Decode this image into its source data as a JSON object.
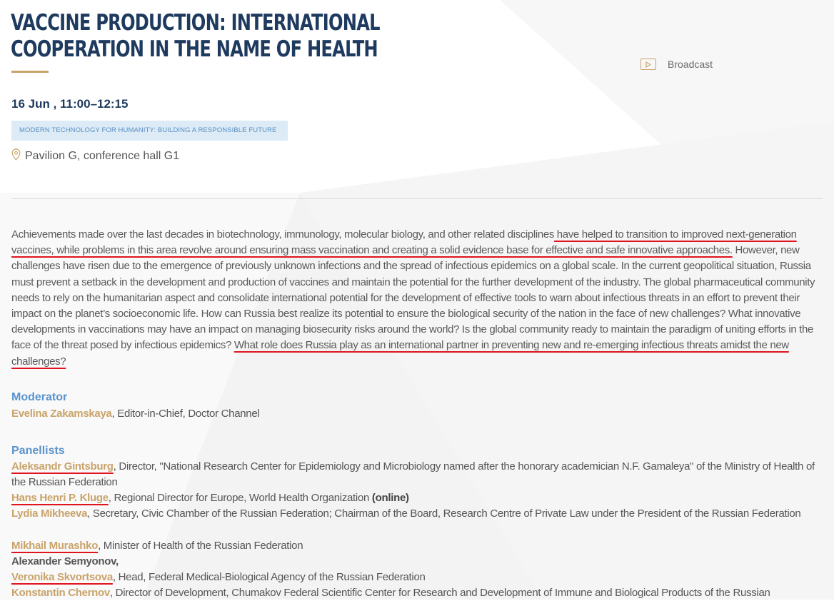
{
  "title": "Vaccine Production: International Cooperation in the Name of Health",
  "broadcast": {
    "label": "Broadcast",
    "icon": "play-icon"
  },
  "date": "16 Jun , 11:00–12:15",
  "tag": "Modern Technology for Humanity: Building a Responsible Future",
  "location": {
    "icon": "location-pin-icon",
    "label": "Pavilion G, conference hall G1"
  },
  "description": {
    "p1": "Achievements made over the last decades in biotechnology, immunology, molecular biology, and other related disciplines",
    "u1": " have helped to transition to improved next-generation vaccines, while problems in this area revolve around ensuring mass vaccination and creating a solid evidence base for effective and safe innovative approaches.",
    "p2": " However, new challenges have risen due to the emergence of previously unknown infections and the spread of infectious epidemics on a global scale. In the current geopolitical situation, Russia must prevent a setback in the development and production of vaccines and maintain the potential for the further development of the industry. The global pharmaceutical community needs to rely on the humanitarian aspect and consolidate international potential for the development of effective tools to warn about infectious threats in an effort to prevent their impact on the planet’s socioeconomic life. How can Russia best realize its potential to ensure the biological security of the nation in the face of new challenges? What innovative developments in vaccinations may have an impact on managing biosecurity risks around the world? Is the global community ready to maintain the paradigm of uniting efforts in the face of the threat posed by infectious epidemics? ",
    "u2": "What role does Russia play as an international partner in preventing new and re-emerging infectious threats amidst the new challenges?"
  },
  "moderator": {
    "heading": "Moderator",
    "name": "Evelina Zakamskaya",
    "role": ", Editor-in-Chief, Doctor Channel"
  },
  "panellists": {
    "heading": "Panellists",
    "items": [
      {
        "name": "Aleksandr Gintsburg",
        "role": ", Director, \"National Research Center for Epidemiology and Microbiology named after the honorary academician N.F. Gamaleya\" of the Ministry of Health of the Russian Federation"
      },
      {
        "name": "Hans Henri P. Kluge",
        "role": ", Regional Director for Europe, World Health Organization ",
        "extra": "(online)"
      },
      {
        "name": "Lydia Mikheeva",
        "role": ", Secretary, Civic Chamber of the Russian Federation; Chairman of the Board, Research Centre of Private Law under the President of the Russian Federation"
      },
      {
        "name": "Mikhail Murashko",
        "role": ", Minister of Health of the Russian Federation"
      },
      {
        "name": "Alexander Semyonov,",
        "role": ""
      },
      {
        "name": "Veronika Skvortsova",
        "role": ", Head, Federal Medical-Biological Agency of the Russian Federation"
      },
      {
        "name": "Konstantin Chernov",
        "role": ", Director of Development, Chumakov Federal Scientific Center for Research and Development of Immune and Biological Products of the Russian"
      }
    ]
  },
  "colors": {
    "navy": "#1e3a5f",
    "gold": "#c9a36a",
    "blue": "#5b93cc",
    "tag_bg": "#dcebf6",
    "underline": "#e0141e"
  }
}
